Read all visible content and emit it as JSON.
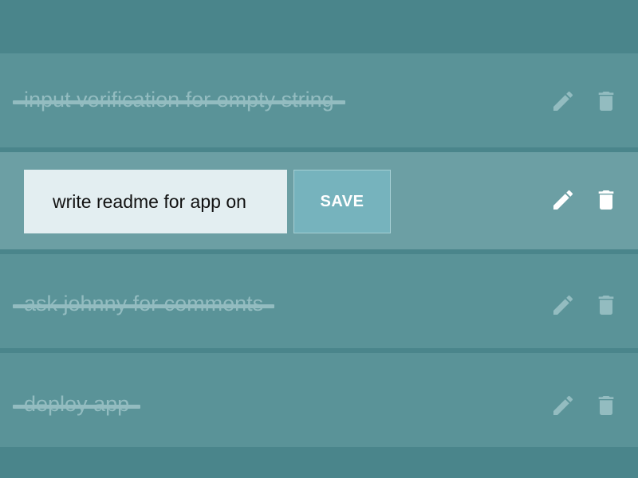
{
  "todos": [
    {
      "text": "input verification for empty string",
      "completed": true
    },
    {
      "text": "write readme for app on",
      "completed": false,
      "editing": true
    },
    {
      "text": "ask johnny for comments",
      "completed": true
    },
    {
      "text": "deploy app",
      "completed": true
    }
  ],
  "edit": {
    "value": "write readme for app on",
    "save_label": "SAVE"
  },
  "icons": {
    "edit": "pencil-icon",
    "delete": "trash-icon"
  },
  "colors": {
    "background": "#4a858b",
    "row": "#5a9398",
    "row_editing": "#6c9fa4",
    "completed_text": "#93bcc0",
    "input_bg": "#e3eef1",
    "save_bg": "#76b3bd"
  }
}
